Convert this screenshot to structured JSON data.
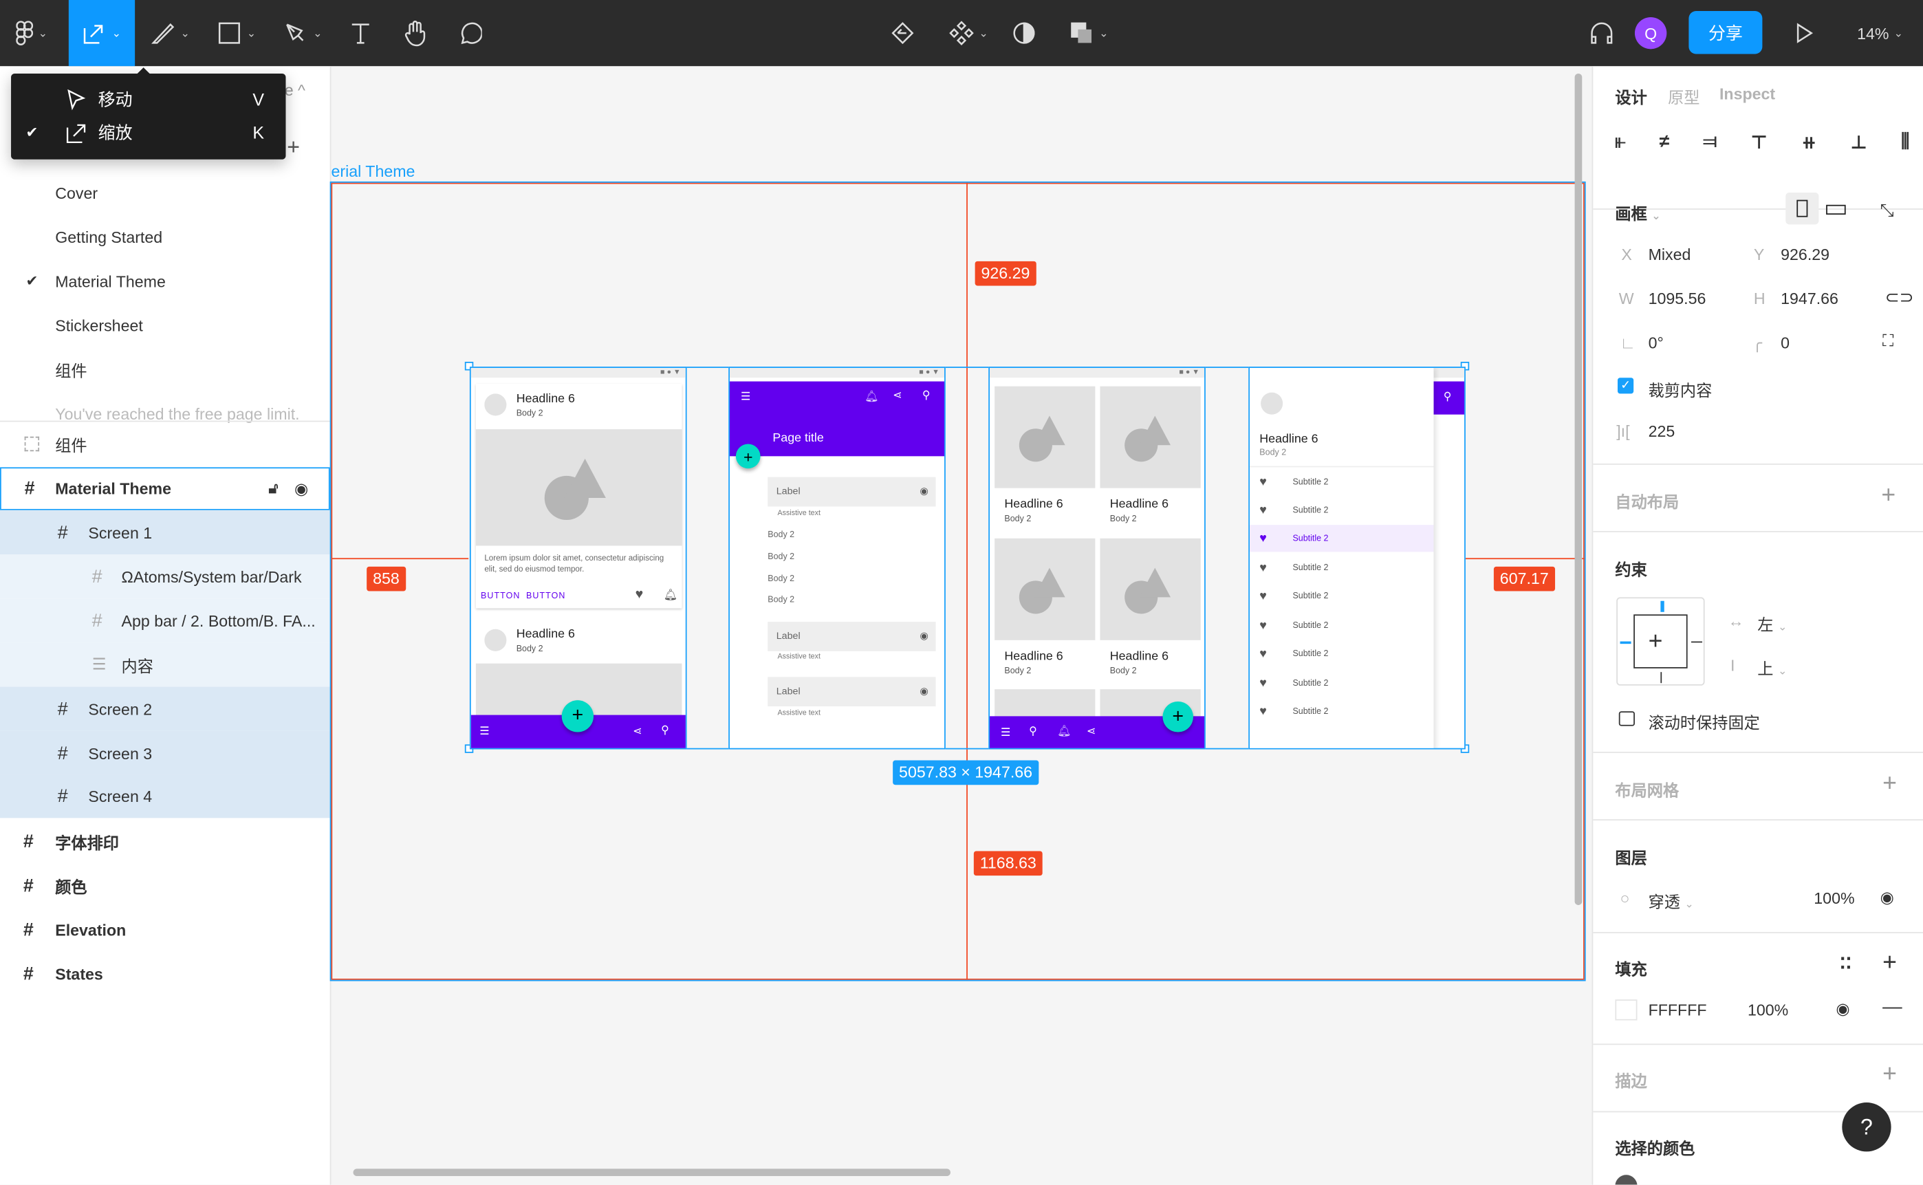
{
  "toolbar": {
    "tools": [
      {
        "name": "figma-menu",
        "icon": "figma-logo-icon"
      },
      {
        "name": "scale-tool",
        "icon": "scale-icon",
        "active": true
      },
      {
        "name": "pencil-tool",
        "icon": "pencil-icon"
      },
      {
        "name": "shape-tool",
        "icon": "rectangle-icon"
      },
      {
        "name": "pen-tool",
        "icon": "pen-icon"
      },
      {
        "name": "text-tool",
        "icon": "text-icon"
      },
      {
        "name": "hand-tool",
        "icon": "hand-icon"
      },
      {
        "name": "comment-tool",
        "icon": "comment-icon"
      }
    ],
    "center_icons": [
      "reset-instance-icon",
      "component-icon",
      "mask-icon",
      "boolean-icon"
    ],
    "avatar_initial": "Q",
    "share_label": "分享",
    "zoom_level": "14%",
    "accent": "#0d99ff"
  },
  "tool_menu": {
    "items": [
      {
        "label": "移动",
        "shortcut": "V",
        "checked": false
      },
      {
        "label": "缩放",
        "shortcut": "K",
        "checked": true
      }
    ]
  },
  "pages": {
    "items": [
      "Cover",
      "Getting Started",
      "Material Theme",
      "Stickersheet",
      "组件"
    ],
    "current": "Material Theme",
    "limit_text": "You've reached the free page limit."
  },
  "layers": {
    "items": [
      {
        "label": "组件",
        "type": "section"
      },
      {
        "label": "Material Theme",
        "type": "frame",
        "selected": true
      },
      {
        "label": "Screen 1",
        "type": "frame"
      },
      {
        "label": "ΩAtoms/System bar/Dark",
        "type": "instance"
      },
      {
        "label": "App bar / 2. Bottom/B. FA...",
        "type": "instance"
      },
      {
        "label": "内容",
        "type": "auto-layout"
      },
      {
        "label": "Screen 2",
        "type": "frame"
      },
      {
        "label": "Screen 3",
        "type": "frame"
      },
      {
        "label": "Screen 4",
        "type": "frame"
      },
      {
        "label": "字体排印",
        "type": "frame"
      },
      {
        "label": "颜色",
        "type": "frame"
      },
      {
        "label": "Elevation",
        "type": "frame"
      },
      {
        "label": "States",
        "type": "frame"
      }
    ]
  },
  "canvas": {
    "frame_title": "erial Theme",
    "measure_top": "926.29",
    "measure_left": "858",
    "measure_right": "607.17",
    "measure_bottom": "1168.63",
    "selection_size": "5057.83 × 1947.66",
    "screen1": {
      "headline": "Headline 6",
      "body": "Body 2",
      "lorem": "Lorem ipsum dolor sit amet, consectetur adipiscing elit, sed do eiusmod tempor.",
      "button1": "BUTTON",
      "button2": "BUTTON",
      "headline2": "Headline 6",
      "body2": "Body 2"
    },
    "screen2": {
      "page_title": "Page title",
      "field_label": "Label",
      "assistive": "Assistive text",
      "body_items": [
        "Body 2",
        "Body 2",
        "Body 2",
        "Body 2"
      ]
    },
    "screen3": {
      "cards": [
        {
          "h": "Headline 6",
          "b": "Body 2"
        },
        {
          "h": "Headline 6",
          "b": "Body 2"
        },
        {
          "h": "Headline 6",
          "b": "Body 2"
        },
        {
          "h": "Headline 6",
          "b": "Body 2"
        }
      ]
    },
    "screen4": {
      "headline": "Headline 6",
      "body": "Body 2",
      "items": [
        "Subtitle 2",
        "Subtitle 2",
        "Subtitle 2",
        "Subtitle 2",
        "Subtitle 2",
        "Subtitle 2",
        "Subtitle 2",
        "Subtitle 2",
        "Subtitle 2"
      ],
      "active_index": 2
    },
    "primary": "#6200ee",
    "secondary": "#03dac5",
    "measure_color": "#f24822"
  },
  "design_panel": {
    "tabs": [
      "设计",
      "原型",
      "Inspect"
    ],
    "active_tab": "设计",
    "frame_label": "画框",
    "x_label": "X",
    "x": "Mixed",
    "y_label": "Y",
    "y": "926.29",
    "w_label": "W",
    "w": "1095.56",
    "h_label": "H",
    "h": "1947.66",
    "rotation": "0°",
    "radius": "0",
    "clip_content_label": "裁剪内容",
    "clip_content": true,
    "spacing": "225",
    "auto_layout": "自动布局",
    "constraints": "约束",
    "constraint_h": "左",
    "constraint_v": "上",
    "fix_scroll_label": "滚动时保持固定",
    "fix_scroll": false,
    "layout_grid": "布局网格",
    "layer": "图层",
    "blend": "穿透",
    "layer_opacity": "100%",
    "fill": "填充",
    "fill_hex": "FFFFFF",
    "fill_opacity": "100%",
    "stroke": "描边",
    "selected_colors": "选择的颜色",
    "help": "?"
  }
}
